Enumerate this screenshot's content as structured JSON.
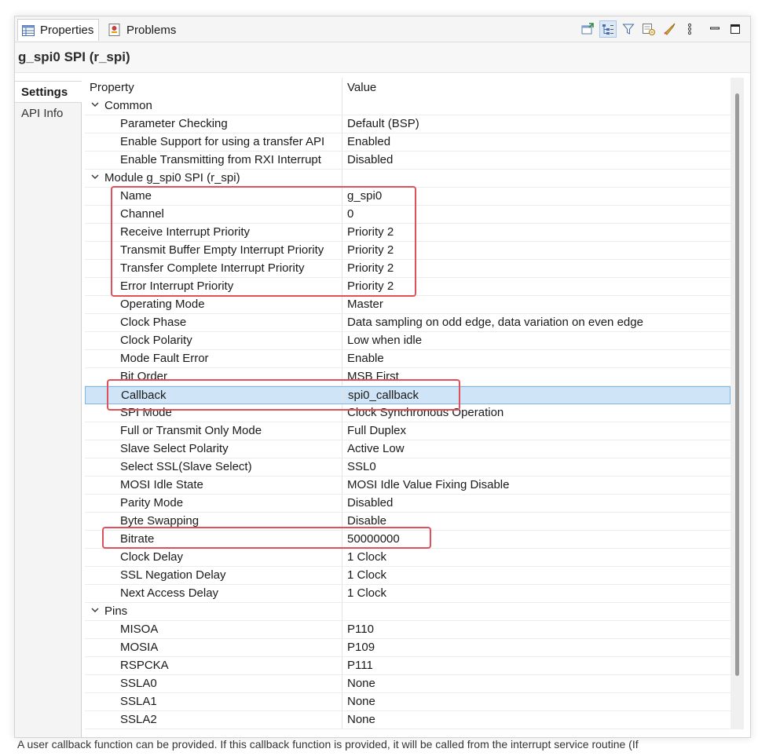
{
  "tabs": [
    {
      "label": "Properties",
      "icon": "properties-table-icon"
    },
    {
      "label": "Problems",
      "icon": "problems-icon"
    }
  ],
  "toolbar": [
    "pin-icon",
    "tree-view-icon",
    "filter-icon",
    "advanced-icon",
    "rocket-icon",
    "menu-icon",
    "minimize-icon",
    "maximize-icon"
  ],
  "title": "g_spi0 SPI (r_spi)",
  "side_tabs": [
    "Settings",
    "API Info"
  ],
  "columns": {
    "property": "Property",
    "value": "Value"
  },
  "groups": {
    "common": "Common",
    "module": "Module g_spi0 SPI (r_spi)",
    "pins": "Pins"
  },
  "common_rows": [
    {
      "property": "Parameter Checking",
      "value": "Default (BSP)"
    },
    {
      "property": "Enable Support for using a transfer API",
      "value": "Enabled"
    },
    {
      "property": "Enable Transmitting from RXI Interrupt",
      "value": "Disabled"
    }
  ],
  "module_rows": [
    {
      "property": "Name",
      "value": "g_spi0"
    },
    {
      "property": "Channel",
      "value": "0"
    },
    {
      "property": "Receive Interrupt Priority",
      "value": "Priority 2"
    },
    {
      "property": "Transmit Buffer Empty Interrupt Priority",
      "value": "Priority 2"
    },
    {
      "property": "Transfer Complete Interrupt Priority",
      "value": "Priority 2"
    },
    {
      "property": "Error Interrupt Priority",
      "value": "Priority 2"
    },
    {
      "property": "Operating Mode",
      "value": "Master"
    },
    {
      "property": "Clock Phase",
      "value": "Data sampling on odd edge, data variation on even edge"
    },
    {
      "property": "Clock Polarity",
      "value": "Low when idle"
    },
    {
      "property": "Mode Fault Error",
      "value": "Enable"
    },
    {
      "property": "Bit Order",
      "value": "MSB First"
    },
    {
      "property": "Callback",
      "value": "spi0_callback"
    },
    {
      "property": "SPI Mode",
      "value": "Clock Synchronous Operation"
    },
    {
      "property": "Full or Transmit Only Mode",
      "value": "Full Duplex"
    },
    {
      "property": "Slave Select Polarity",
      "value": "Active Low"
    },
    {
      "property": "Select SSL(Slave Select)",
      "value": "SSL0"
    },
    {
      "property": "MOSI Idle State",
      "value": "MOSI Idle Value Fixing Disable"
    },
    {
      "property": "Parity Mode",
      "value": "Disabled"
    },
    {
      "property": "Byte Swapping",
      "value": "Disable"
    },
    {
      "property": "Bitrate",
      "value": "50000000"
    },
    {
      "property": "Clock Delay",
      "value": "1 Clock"
    },
    {
      "property": "SSL Negation Delay",
      "value": "1 Clock"
    },
    {
      "property": "Next Access Delay",
      "value": "1 Clock"
    }
  ],
  "pin_rows": [
    {
      "property": "MISOA",
      "value": "P110"
    },
    {
      "property": "MOSIA",
      "value": "P109"
    },
    {
      "property": "RSPCKA",
      "value": "P111"
    },
    {
      "property": "SSLA0",
      "value": "None"
    },
    {
      "property": "SSLA1",
      "value": "None"
    },
    {
      "property": "SSLA2",
      "value": "None"
    }
  ],
  "selected_property": "Callback",
  "colors": {
    "selection": "#cfe5f7",
    "highlight": "#e0505a"
  },
  "description": "A user callback function can be provided. If this callback function is provided, it will be called from the interrupt service routine (If"
}
